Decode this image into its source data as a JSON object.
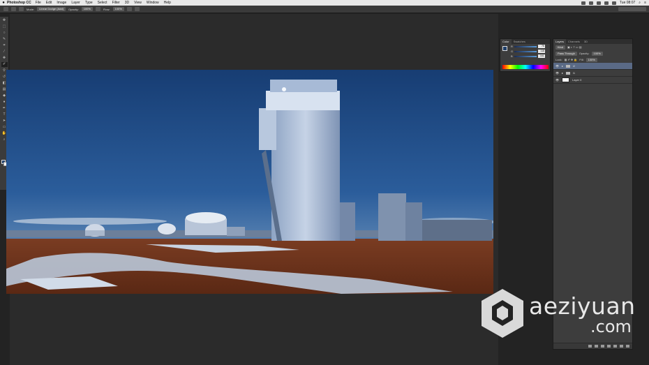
{
  "menubar": {
    "app_name": "Photoshop CC",
    "items": [
      "File",
      "Edit",
      "Image",
      "Layer",
      "Type",
      "Select",
      "Filter",
      "3D",
      "View",
      "Window",
      "Help"
    ],
    "clock": "Tue 08:07"
  },
  "options": {
    "mode_label": "Mode:",
    "mode_value": "Linear Dodge (Add)",
    "opacity_label": "Opacity:",
    "opacity_value": "100%",
    "flow_label": "Flow:",
    "flow_value": "100%"
  },
  "color_panel": {
    "tabs": [
      "Color",
      "Swatches"
    ],
    "r_label": "R",
    "r_value": "75",
    "g_label": "G",
    "g_value": "118",
    "b_label": "B",
    "b_value": "161"
  },
  "layers_panel": {
    "tabs": [
      "Layers",
      "Channels",
      "3D"
    ],
    "kind_label": "Kind",
    "blend_mode": "Pass Through",
    "opacity_label": "Opacity:",
    "opacity_value": "100%",
    "lock_label": "Lock:",
    "fill_label": "Fill:",
    "fill_value": "100%",
    "layers": [
      {
        "name": "i2",
        "type": "group",
        "selected": true
      },
      {
        "name": "i1",
        "type": "group",
        "selected": false
      },
      {
        "name": "Layer 0",
        "type": "layer",
        "selected": false
      }
    ]
  },
  "watermark": {
    "line1": "aeziyuan",
    "line2": ".com"
  }
}
